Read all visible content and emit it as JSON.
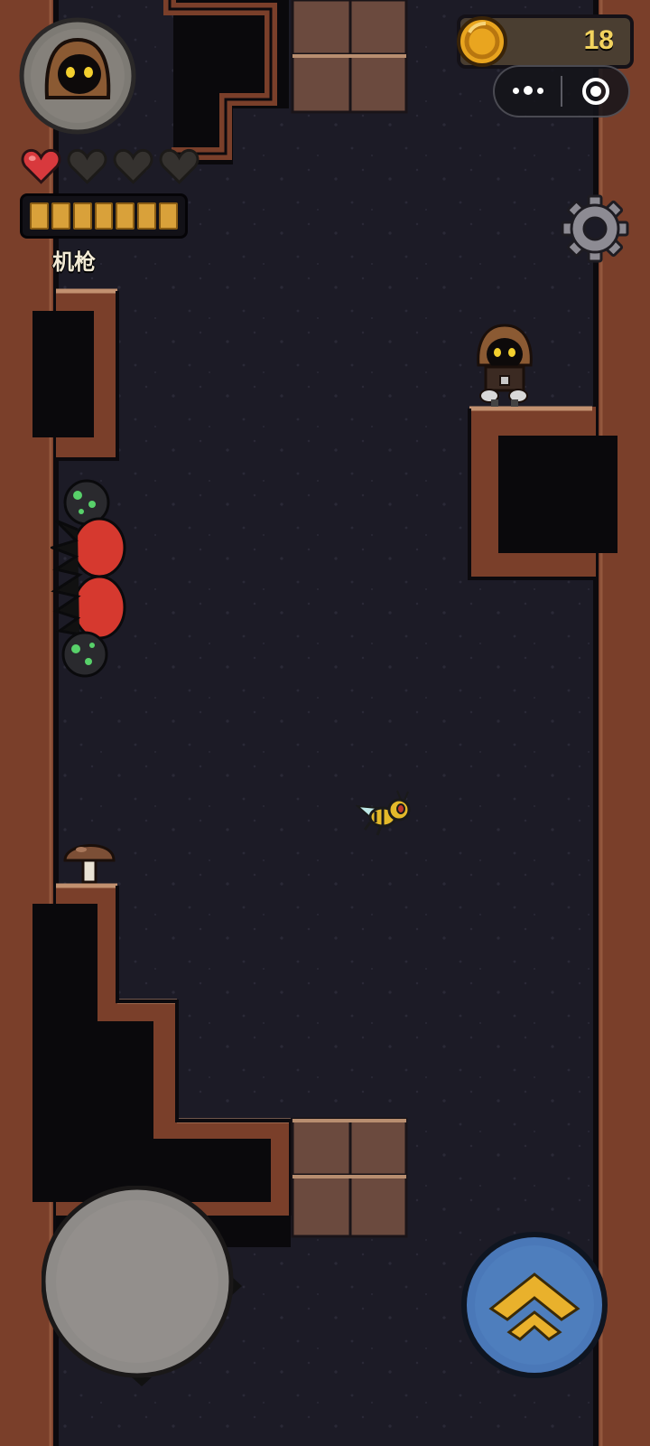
{
  "hud": {
    "portrait_icon": "hooded-hero-portrait",
    "hearts": {
      "total": 4,
      "filled": 1,
      "icon": "heart-icon"
    },
    "ammo": {
      "total": 7,
      "filled": 7,
      "color": "#d9a13a"
    },
    "weapon_label": "机枪",
    "coins": {
      "count": "18",
      "icon": "coin-icon",
      "color": "#f2d35e"
    },
    "settings_icon": "gear-icon"
  },
  "mini_program_capsule": {
    "more_icon": "more-dots-icon",
    "close_icon": "target-close-icon"
  },
  "entities": {
    "player": "hooded-player",
    "enemies": [
      "red-spiked-caterpillar",
      "wasp"
    ],
    "pickups": [
      "mushroom"
    ]
  },
  "controls": {
    "joystick": "virtual-joystick",
    "jump_button": "jump-chevron-icon"
  },
  "colors": {
    "cave_background": "#1c1b26",
    "rock_wall": "#7a3f2a",
    "rock_edge": "#b27a58",
    "void": "#08070a",
    "jump_button": "#4a78b8",
    "chevron": "#e9b12c"
  }
}
